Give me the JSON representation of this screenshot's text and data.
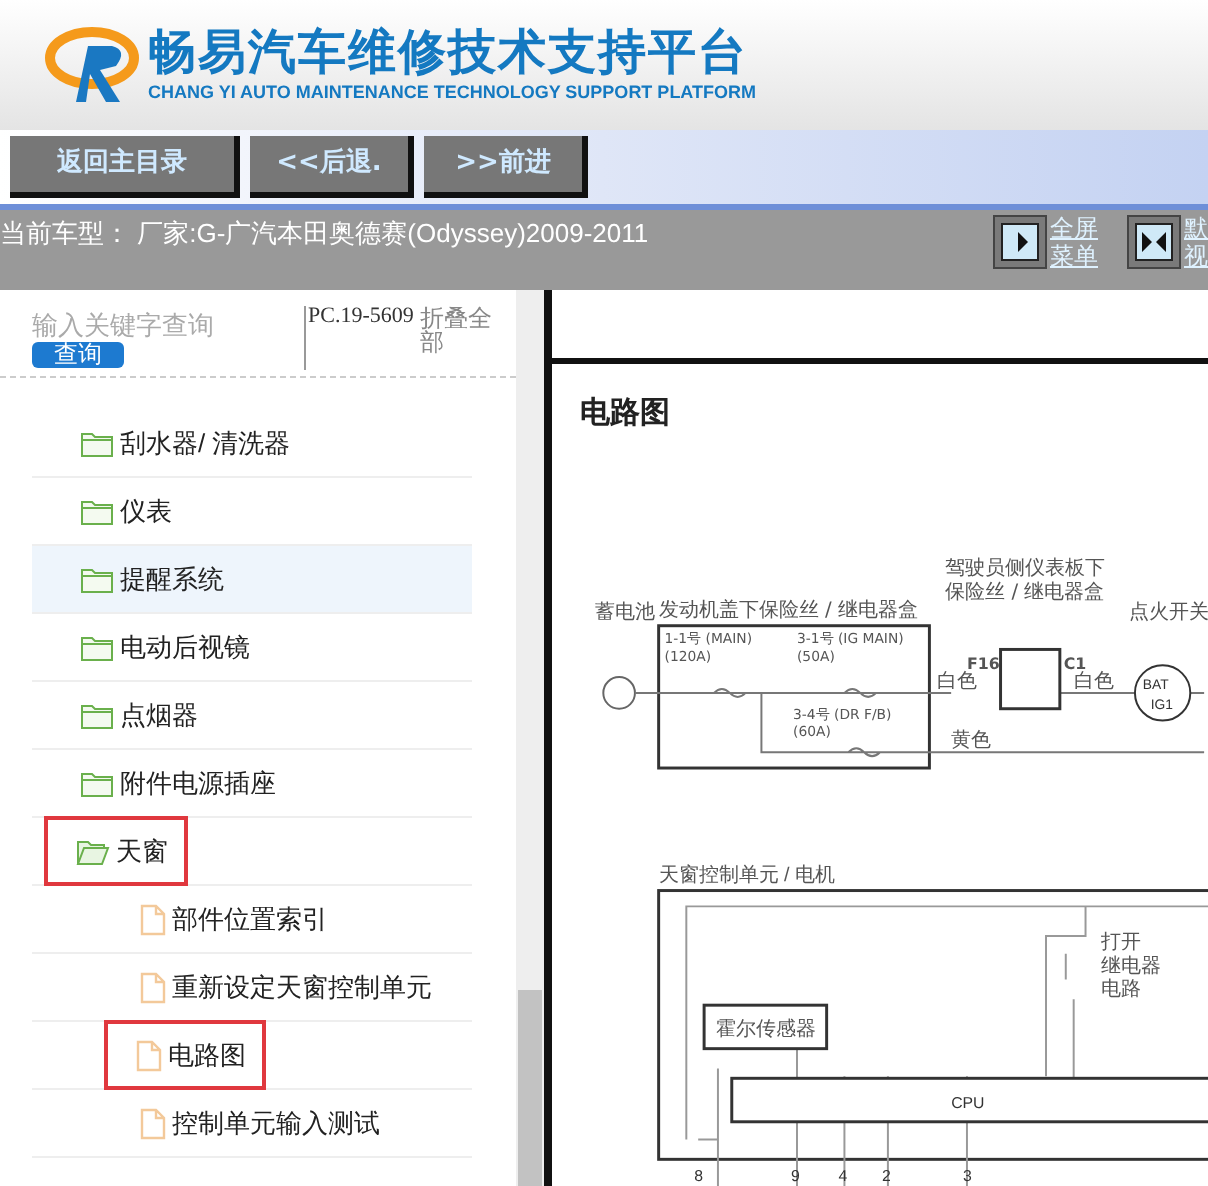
{
  "header": {
    "title": "畅易汽车维修技术支持平台",
    "subtitle": "CHANG YI AUTO MAINTENANCE TECHNOLOGY SUPPORT PLATFORM"
  },
  "nav_buttons": [
    "返回主目录",
    "<<后退.",
    ">>前进"
  ],
  "info_bar": {
    "current_model": "当前车型： 厂家:G-广汽本田奥德赛(Odyssey)2009-2011",
    "tools": [
      {
        "kind": "fullscreen",
        "lines": [
          "全屏",
          "菜单"
        ]
      },
      {
        "kind": "default",
        "lines": [
          "默",
          "视"
        ]
      }
    ]
  },
  "search": {
    "placeholder": "输入关键字查询",
    "button": "查询",
    "code": "PC.19-5609",
    "collapse": "折叠全部"
  },
  "tree": [
    {
      "label": "刮水器/ 清洗器",
      "kind": "folder",
      "expanded": false,
      "highlighted": false,
      "marked": false
    },
    {
      "label": "仪表",
      "kind": "folder",
      "expanded": false,
      "highlighted": false,
      "marked": false
    },
    {
      "label": "提醒系统",
      "kind": "folder",
      "expanded": false,
      "highlighted": true,
      "marked": false
    },
    {
      "label": "电动后视镜",
      "kind": "folder",
      "expanded": false,
      "highlighted": false,
      "marked": false
    },
    {
      "label": "点烟器",
      "kind": "folder",
      "expanded": false,
      "highlighted": false,
      "marked": false
    },
    {
      "label": "附件电源插座",
      "kind": "folder",
      "expanded": false,
      "highlighted": false,
      "marked": false
    },
    {
      "label": "天窗",
      "kind": "folder",
      "expanded": true,
      "highlighted": false,
      "marked": true,
      "children": [
        {
          "label": "部件位置索引",
          "kind": "file",
          "highlighted": false,
          "marked": false
        },
        {
          "label": "重新设定天窗控制单元",
          "kind": "file",
          "highlighted": false,
          "marked": false
        },
        {
          "label": "电路图",
          "kind": "file",
          "highlighted": false,
          "marked": true
        },
        {
          "label": "控制单元输入测试",
          "kind": "file",
          "highlighted": false,
          "marked": false
        }
      ]
    }
  ],
  "document": {
    "title": "电路图",
    "diagram": {
      "battery": "蓄电池",
      "fuse_box": "发动机盖下保险丝 / 继电器盒",
      "fuses": [
        [
          "1-1号 (MAIN)",
          "(120A)"
        ],
        [
          "3-1号 (IG MAIN)",
          "(50A)"
        ],
        [
          "3-4号 (DR F/B)",
          "(60A)"
        ]
      ],
      "dash_box": [
        "驾驶员侧仪表板下",
        "保险丝 / 继电器盒"
      ],
      "pin_in": "F16",
      "pin_out": "C1",
      "wire_white": [
        "白色",
        "白色"
      ],
      "wire_yellow": "黄色",
      "ignition": "点火开关",
      "ignition_pins": [
        "BAT",
        "IG1"
      ],
      "control_unit": "天窗控制单元 / 电机",
      "relay": [
        "打开",
        "继电器",
        "电路"
      ],
      "hall_sensor": "霍尔传感器",
      "cpu": "CPU",
      "pins": [
        "8",
        "9",
        "4",
        "2",
        "3"
      ]
    }
  }
}
